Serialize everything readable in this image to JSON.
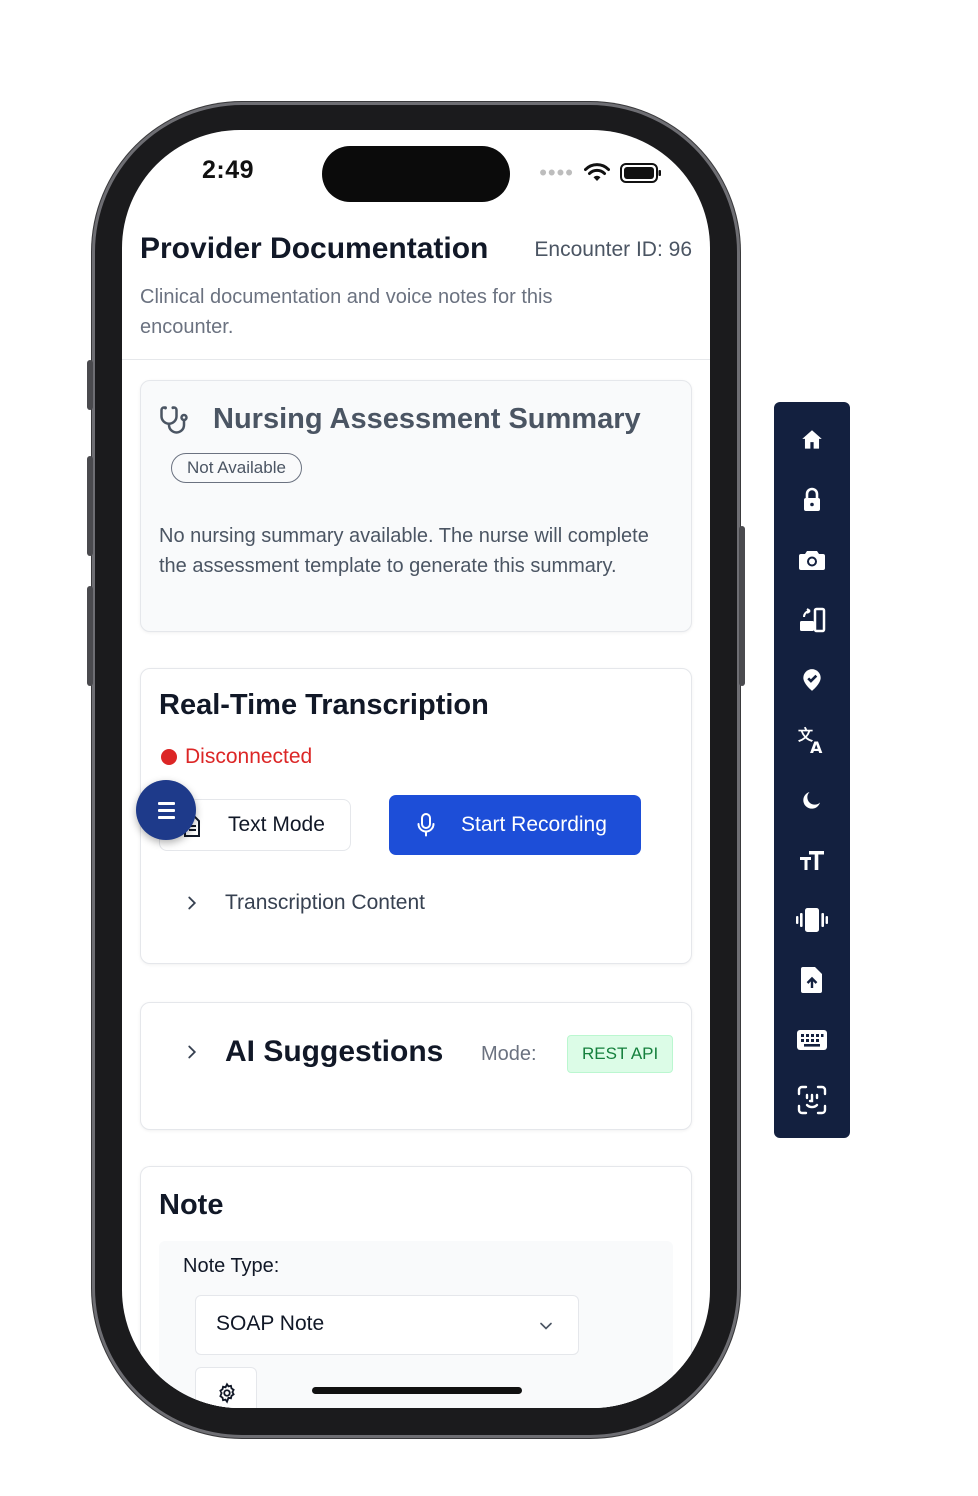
{
  "status_bar": {
    "time": "2:49"
  },
  "header": {
    "title": "Provider Documentation",
    "encounter_id": "Encounter ID: 96",
    "subtitle": "Clinical documentation and voice notes for this encounter."
  },
  "nursing_card": {
    "title": "Nursing Assessment Summary",
    "badge": "Not Available",
    "body": "No nursing summary available. The nurse will complete the assessment template to generate this summary."
  },
  "transcription_card": {
    "title": "Real-Time Transcription",
    "status": "Disconnected",
    "text_mode_label": "Text Mode",
    "record_label": "Start Recording",
    "content_label": "Transcription Content"
  },
  "ai_card": {
    "title": "AI Suggestions",
    "mode_label": "Mode:",
    "mode_badge": "REST API"
  },
  "note_card": {
    "title": "Note",
    "type_label": "Note Type:",
    "type_value": "SOAP Note"
  },
  "colors": {
    "primary": "#1d4ed8",
    "fab": "#1e3a8a",
    "disconnected": "#dc2626",
    "badge_green": "#15803d",
    "toolbar_bg": "#13203f"
  },
  "toolbar": {
    "items": [
      "home-icon",
      "lock-icon",
      "camera-icon",
      "rotate-icon",
      "location-check-icon",
      "translate-icon",
      "dark-mode-icon",
      "text-size-icon",
      "vibrate-icon",
      "file-upload-icon",
      "keyboard-icon",
      "face-id-icon"
    ]
  }
}
